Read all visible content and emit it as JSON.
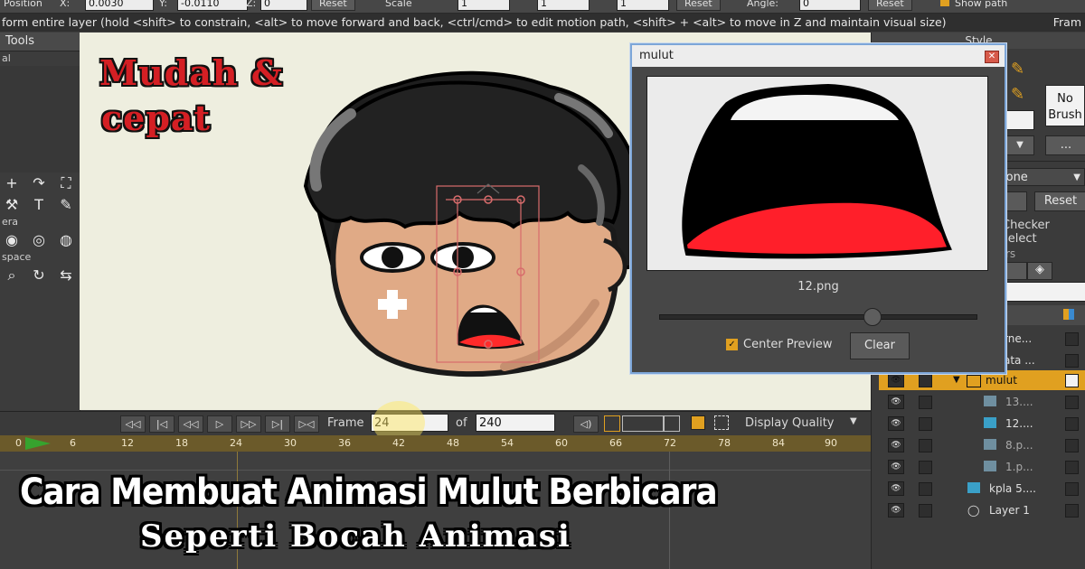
{
  "optionsbar": {
    "position_label": "Position",
    "x_label": "X:",
    "x_value": "0.0030",
    "y_label": "Y:",
    "y_value": "-0.0110",
    "z_label": "Z:",
    "z_value": "0",
    "reset1": "Reset",
    "scale_label": "Scale",
    "sx_value": "1",
    "sy_value": "1",
    "sz_value": "1",
    "reset2": "Reset",
    "angle_label": "Angle:",
    "angle_value": "0",
    "reset3": "Reset",
    "show_path": "Show path"
  },
  "hint": {
    "text": "form entire layer (hold <shift> to constrain, <alt> to move forward and back, <ctrl/cmd> to edit motion path, <shift> + <alt> to move in Z and maintain visual size)",
    "right": "Fram"
  },
  "tools": {
    "header": "Tools",
    "sub_al": "al",
    "sub_era": "era",
    "sub_space": "space"
  },
  "canvas": {
    "badge_line1": "Mudah &",
    "badge_line2": "cepat"
  },
  "transport": {
    "frame_label": "Frame",
    "frame_value": "24",
    "of_label": "of",
    "total_value": "240",
    "display_quality": "Display Quality"
  },
  "ruler": {
    "ticks": [
      "0",
      "6",
      "12",
      "18",
      "24",
      "30",
      "36",
      "42",
      "48",
      "54",
      "60",
      "66",
      "72",
      "78",
      "84",
      "90"
    ]
  },
  "overlay": {
    "title_line1": "Cara Membuat Animasi Mulut Berbicara",
    "title_line2": "Seperti Bocah Animasi"
  },
  "dialog": {
    "title": "mulut",
    "filename": "12.png",
    "center_preview": "Center Preview",
    "clear": "Clear",
    "center_preview_checked": true
  },
  "style_panel": {
    "header": "Style",
    "no_brush": "No Brush",
    "none_label": "lone",
    "reset": "Reset",
    "checker": "Checker select",
    "layers_label": "rs"
  },
  "layers": [
    {
      "name": "rne...",
      "indent": 0
    },
    {
      "name": "ata ...",
      "indent": 0
    },
    {
      "name": "mulut",
      "indent": 1,
      "selected": true
    },
    {
      "name": "13....",
      "indent": 2
    },
    {
      "name": "12....",
      "indent": 2
    },
    {
      "name": "8.p...",
      "indent": 2
    },
    {
      "name": "1.p...",
      "indent": 2
    },
    {
      "name": "kpla 5....",
      "indent": 1
    },
    {
      "name": "Layer 1",
      "indent": 1
    }
  ],
  "colors": {
    "accent": "#e0a020",
    "badge_red": "#d41f24",
    "timeline": "#6b5a2a",
    "mouth_red": "#ff1f2a"
  }
}
